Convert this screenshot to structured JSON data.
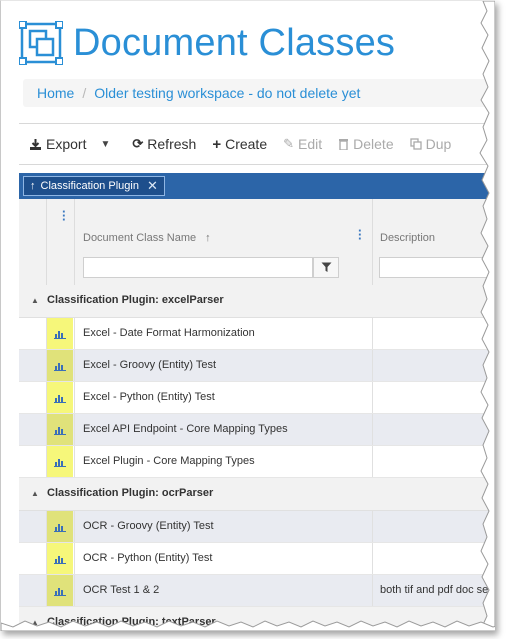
{
  "page": {
    "title": "Document Classes"
  },
  "breadcrumb": {
    "home": "Home",
    "separator": "/",
    "current": "Older testing workspace - do not delete yet"
  },
  "toolbar": {
    "export": "Export",
    "refresh": "Refresh",
    "create": "Create",
    "edit": "Edit",
    "delete": "Delete",
    "duplicate": "Dup"
  },
  "grouping": {
    "chip_label": "Classification Plugin"
  },
  "grid": {
    "columns": {
      "name": "Document Class Name",
      "description": "Description"
    },
    "groups": [
      {
        "label": "Classification Plugin: excelParser",
        "rows": [
          {
            "name": "Excel - Date Format Harmonization",
            "description": ""
          },
          {
            "name": "Excel - Groovy (Entity) Test",
            "description": ""
          },
          {
            "name": "Excel - Python (Entity) Test",
            "description": ""
          },
          {
            "name": "Excel API Endpoint - Core Mapping Types",
            "description": ""
          },
          {
            "name": "Excel Plugin - Core Mapping Types",
            "description": ""
          }
        ]
      },
      {
        "label": "Classification Plugin: ocrParser",
        "rows": [
          {
            "name": "OCR - Groovy (Entity) Test",
            "description": ""
          },
          {
            "name": "OCR - Python (Entity) Test",
            "description": ""
          },
          {
            "name": "OCR Test 1 & 2",
            "description": "both tif and pdf doc se"
          }
        ]
      },
      {
        "label": "Classification Plugin: textParser",
        "rows": []
      }
    ]
  },
  "colors": {
    "title_blue": "#2a8fd6",
    "group_bar": "#2c65a8",
    "row_highlight": "#f6f77a",
    "chart_icon": "#3a6fb8"
  }
}
